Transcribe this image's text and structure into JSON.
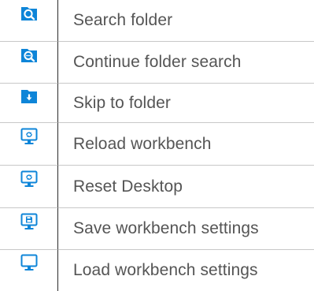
{
  "theme": {
    "accent": "#0e85d8",
    "text": "#555555",
    "divider": "#c8c8c8"
  },
  "menu": {
    "items": [
      {
        "icon": "search-folder-icon",
        "label": "Search folder"
      },
      {
        "icon": "continue-search-icon",
        "label": "Continue folder search"
      },
      {
        "icon": "skip-to-folder-icon",
        "label": "Skip to folder"
      },
      {
        "icon": "reload-monitor-icon",
        "label": "Reload workbench"
      },
      {
        "icon": "reset-monitor-icon",
        "label": "Reset Desktop"
      },
      {
        "icon": "save-monitor-icon",
        "label": "Save workbench settings"
      },
      {
        "icon": "monitor-icon",
        "label": "Load workbench settings"
      }
    ]
  }
}
